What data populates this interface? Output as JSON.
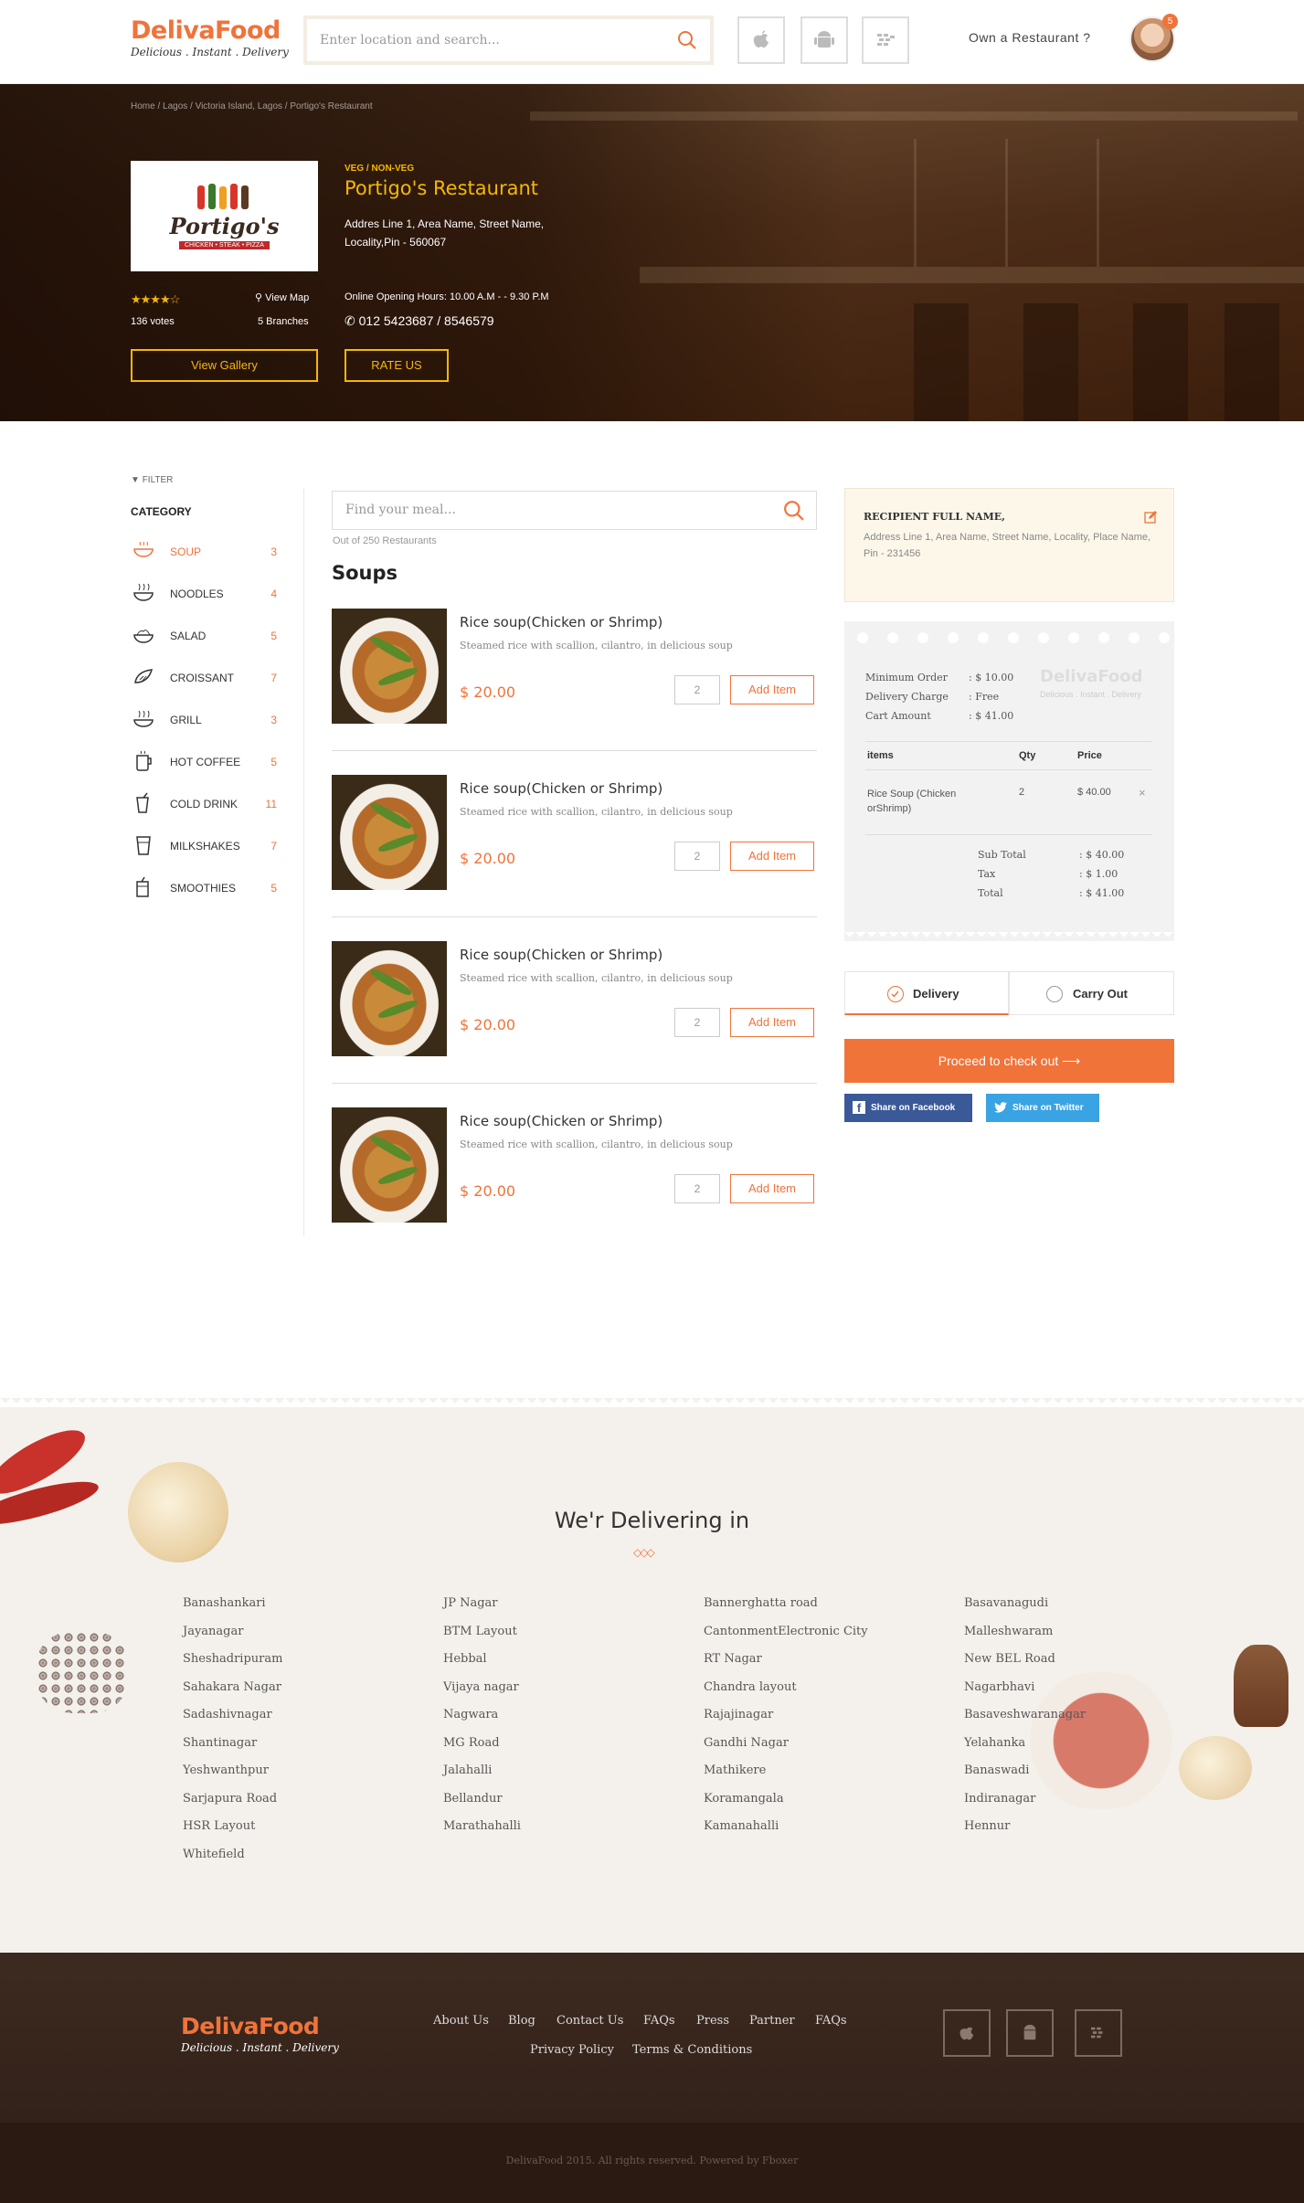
{
  "header": {
    "brand": "DelivaFood",
    "tagline": "Delicious . Instant . Delivery",
    "search_placeholder": "Enter location and search...",
    "own_restaurant": "Own a Restaurant ?",
    "notification_count": "5"
  },
  "hero": {
    "breadcrumb": "Home  /  Lagos  /  Victoria Island, Lagos  /  Portigo's Restaurant",
    "logo_name": "Portigo's",
    "logo_sub": "CHICKEN • STEAK • PIZZA",
    "veg_tag": "VEG / NON-VEG",
    "name": "Portigo's Restaurant",
    "address_line1": "Addres Line 1, Area Name, Street Name,",
    "address_line2": "Locality,Pin - 560067",
    "rating": 4,
    "stars": "★★★★☆",
    "votes": "136 votes",
    "view_map": "View Map",
    "branches": "5 Branches",
    "hours": "Online Opening Hours: 10.00 A.M - - 9.30 P.M",
    "phone": "012 5423687 / 8546579",
    "gallery_btn": "View Gallery",
    "rate_btn": "RATE US"
  },
  "sidebar": {
    "filter": "FILTER",
    "category_title": "CATEGORY",
    "categories": [
      {
        "name": "SOUP",
        "count": "3",
        "icon": "soup-bowl-icon",
        "active": true
      },
      {
        "name": "NOODLES",
        "count": "4",
        "icon": "noodles-icon"
      },
      {
        "name": "SALAD",
        "count": "5",
        "icon": "salad-icon"
      },
      {
        "name": "CROISSANT",
        "count": "7",
        "icon": "croissant-icon"
      },
      {
        "name": "GRILL",
        "count": "3",
        "icon": "grill-icon"
      },
      {
        "name": "HOT COFFEE",
        "count": "5",
        "icon": "hot-coffee-icon"
      },
      {
        "name": "COLD DRINK",
        "count": "11",
        "icon": "cold-drink-icon"
      },
      {
        "name": "MILKSHAKES",
        "count": "7",
        "icon": "milkshake-icon"
      },
      {
        "name": "SMOOTHIES",
        "count": "5",
        "icon": "smoothie-icon"
      }
    ]
  },
  "menu": {
    "search_placeholder": "Find your meal...",
    "out_of": "Out of 250 Restaurants",
    "section": "Soups",
    "items": [
      {
        "title": "Rice soup(Chicken or Shrimp)",
        "desc": "Steamed rice with scallion, cilantro, in delicious soup",
        "price": "$ 20.00",
        "qty": "2",
        "add": "Add Item"
      },
      {
        "title": "Rice soup(Chicken or Shrimp)",
        "desc": "Steamed rice with scallion, cilantro, in delicious soup",
        "price": "$ 20.00",
        "qty": "2",
        "add": "Add Item"
      },
      {
        "title": "Rice soup(Chicken or Shrimp)",
        "desc": "Steamed rice with scallion, cilantro, in delicious soup",
        "price": "$ 20.00",
        "qty": "2",
        "add": "Add Item"
      },
      {
        "title": "Rice soup(Chicken or Shrimp)",
        "desc": "Steamed rice with scallion, cilantro, in delicious soup",
        "price": "$ 20.00",
        "qty": "2",
        "add": "Add Item"
      }
    ]
  },
  "cart": {
    "recipient_name": "RECIPIENT FULL NAME,",
    "recipient_address": "Address Line 1, Area Name, Street Name, Locality, Place Name, Pin - 231456",
    "min_order_label": "Minimum Order",
    "min_order": ": $ 10.00",
    "delivery_label": "Delivery Charge",
    "delivery": ": Free",
    "cart_amount_label": "Cart Amount",
    "cart_amount": ": $ 41.00",
    "watermark": "DelivaFood",
    "watermark_sub": "Delicious . Instant . Delivery",
    "col_items": "items",
    "col_qty": "Qty",
    "col_price": "Price",
    "line_name": "Rice Soup (Chicken orShrimp)",
    "line_qty": "2",
    "line_price": "$ 40.00",
    "remove": "×",
    "subtotal_label": "Sub Total",
    "subtotal": ": $ 40.00",
    "tax_label": "Tax",
    "tax": ": $ 1.00",
    "total_label": "Total",
    "total": ": $ 41.00",
    "delivery_option": "Delivery",
    "carryout_option": "Carry Out",
    "checkout": "Proceed to check out",
    "facebook": "Share on Facebook",
    "twitter": "Share on Twitter"
  },
  "delivering": {
    "title": "We'r Delivering in",
    "columns": [
      [
        "Banashankari",
        "Jayanagar",
        "Sheshadripuram",
        "Sahakara Nagar",
        "Sadashivnagar",
        "Shantinagar",
        "Yeshwanthpur",
        "Sarjapura Road",
        "HSR Layout",
        "Whitefield"
      ],
      [
        "JP Nagar",
        "BTM Layout",
        "Hebbal",
        "Vijaya nagar",
        "Nagwara",
        "MG Road",
        "Jalahalli",
        "Bellandur",
        "Marathahalli"
      ],
      [
        "Bannerghatta road",
        "CantonmentElectronic City",
        "RT Nagar",
        "Chandra layout",
        "Rajajinagar",
        "Gandhi Nagar",
        "Mathikere",
        "Koramangala",
        "Kamanahalli"
      ],
      [
        "Basavanagudi",
        "Malleshwaram",
        "New BEL Road",
        "Nagarbhavi",
        "Basaveshwaranagar",
        "Yelahanka",
        "Banaswadi",
        "Indiranagar",
        "Hennur"
      ]
    ]
  },
  "footer": {
    "brand": "DelivaFood",
    "tagline": "Delicious . Instant . Delivery",
    "links": [
      "About Us",
      "Blog",
      "Contact Us",
      "FAQs",
      "Press",
      "Partner",
      "FAQs"
    ],
    "links2": [
      "Privacy Policy",
      "Terms & Conditions"
    ],
    "copyright": "DelivaFood 2015. All rights reserved. Powered by Fboxer"
  },
  "colors": {
    "accent": "#f0733a",
    "gold": "#f5b800",
    "footer": "#3d2a20"
  }
}
